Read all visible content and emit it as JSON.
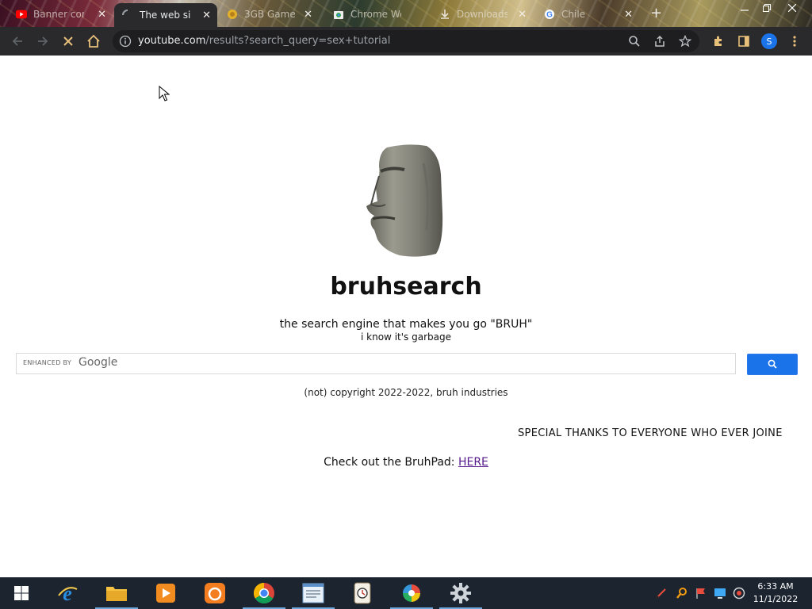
{
  "browser": {
    "tabs": [
      {
        "title": "Banner con",
        "icon": "youtube-icon",
        "active": false
      },
      {
        "title": "The web site",
        "icon": "loading-spinner-icon",
        "active": true
      },
      {
        "title": "3GB Game",
        "icon": "coin-icon",
        "active": false
      },
      {
        "title": "Chrome We",
        "icon": "chrome-web-store-icon",
        "active": false
      },
      {
        "title": "Downloads",
        "icon": "download-icon",
        "active": false
      },
      {
        "title": "Chile",
        "icon": "google-icon",
        "active": false
      }
    ],
    "tab_close_glyph": "✕",
    "new_tab_glyph": "+",
    "url_host": "youtube.com",
    "url_path": "/results?search_query=sex+tutorial",
    "profile_initial": "S"
  },
  "page": {
    "title": "bruhsearch",
    "tagline": "the search engine that makes you go \"BRUH\"",
    "subtagline": "i know it's garbage",
    "search": {
      "enhanced_by": "ENHANCED BY",
      "provider": "Google",
      "value": ""
    },
    "copyright": "(not) copyright 2022-2022, bruh industries",
    "marquee": "SPECIAL THANKS TO EVERYONE WHO EVER JOINE",
    "bruhpad_prefix": "Check out the BruhPad: ",
    "bruhpad_link": "HERE"
  },
  "taskbar": {
    "apps": [
      "windows-start-icon",
      "internet-explorer-icon",
      "file-explorer-icon",
      "media-player-icon",
      "uc-browser-icon",
      "chrome-icon",
      "notepad-icon",
      "clock-app-icon",
      "colorful-app-icon",
      "gear-app-icon"
    ],
    "time": "6:33 AM",
    "date": "11/1/2022"
  }
}
